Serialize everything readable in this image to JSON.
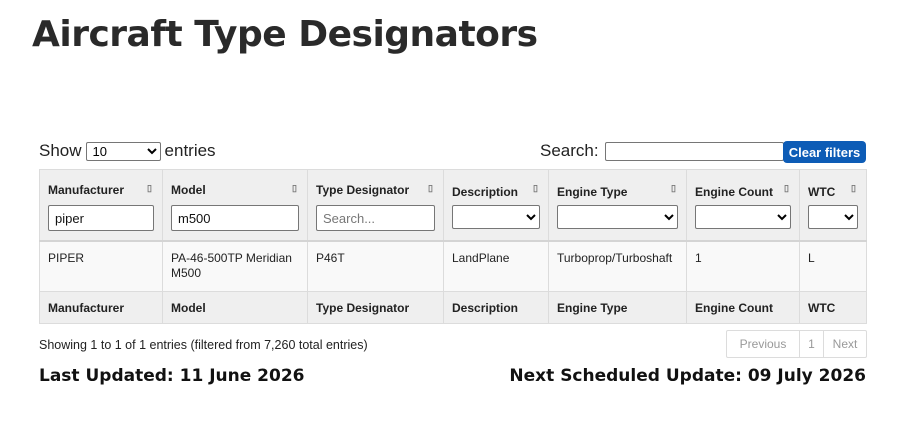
{
  "page": {
    "title": "Aircraft Type Designators"
  },
  "controls": {
    "show_label": "Show",
    "entries_label": "entries",
    "page_length": "10",
    "search_label": "Search:",
    "search_value": "",
    "clear_filters_label": "Clear filters"
  },
  "table": {
    "columns": [
      "Manufacturer",
      "Model",
      "Type Designator",
      "Description",
      "Engine Type",
      "Engine Count",
      "WTC"
    ],
    "filters": {
      "manufacturer": "piper",
      "model": "m500",
      "type_designator_placeholder": "Search..."
    },
    "rows": [
      [
        "PIPER",
        "PA-46-500TP Meridian M500",
        "P46T",
        "LandPlane",
        "Turboprop/Turboshaft",
        "1",
        "L"
      ]
    ]
  },
  "footer": {
    "info": "Showing 1 to 1 of 1 entries (filtered from 7,260 total entries)",
    "pager": {
      "previous": "Previous",
      "page": "1",
      "next": "Next"
    },
    "last_updated": "Last Updated: 11 June 2026",
    "next_update": "Next Scheduled Update: 09 July 2026"
  }
}
